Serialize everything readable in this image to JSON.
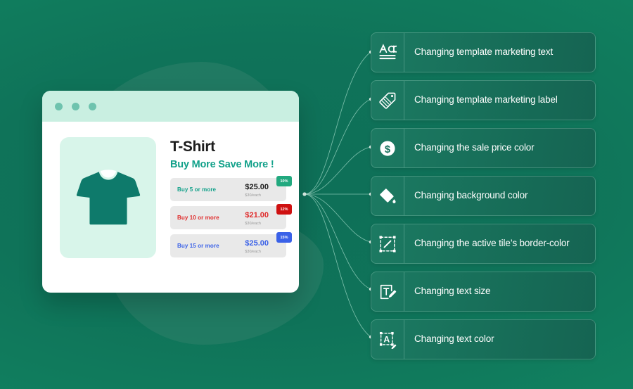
{
  "theme": {
    "background_dark": "#0e6f58",
    "background_light": "#12886a",
    "blob_color": "#2f7f6a",
    "card_color": "#1c7a62",
    "accent_teal": "#12a18a",
    "connector_color": "#9fd8c6"
  },
  "browser": {
    "window_dots": [
      "dot-1",
      "dot-2",
      "dot-3"
    ],
    "product": {
      "image_alt": "t-shirt-illustration",
      "title": "T-Shirt",
      "subtitle": "Buy More Save More !",
      "tiers": [
        {
          "qty_label": "Buy 5 or more",
          "price": "$25.00",
          "unit_price": "$30/each",
          "badge": "10%",
          "qty_color": "#12a18a",
          "price_color": "#1d1d1d",
          "badge_color": "#22a97f"
        },
        {
          "qty_label": "Buy 10 or more",
          "price": "$21.00",
          "unit_price": "$30/each",
          "badge": "12%",
          "qty_color": "#e02b2b",
          "price_color": "#e02b2b",
          "badge_color": "#cf1111"
        },
        {
          "qty_label": "Buy 15 or more",
          "price": "$25.00",
          "unit_price": "$30/each",
          "badge": "15%",
          "qty_color": "#3a61e8",
          "price_color": "#3a61e8",
          "badge_color": "#3a61e8"
        }
      ]
    }
  },
  "features": [
    {
      "icon": "text-format-aa-icon",
      "label": "Changing template marketing text"
    },
    {
      "icon": "price-tag-icon",
      "label": "Changing template marketing label"
    },
    {
      "icon": "dollar-coin-icon",
      "label": "Changing the sale price color"
    },
    {
      "icon": "paint-bucket-icon",
      "label": "Changing background color"
    },
    {
      "icon": "border-edit-icon",
      "label": "Changing the active tile’s border-color"
    },
    {
      "icon": "text-size-edit-icon",
      "label": "Changing text size"
    },
    {
      "icon": "text-color-edit-icon",
      "label": "Changing text color"
    }
  ]
}
